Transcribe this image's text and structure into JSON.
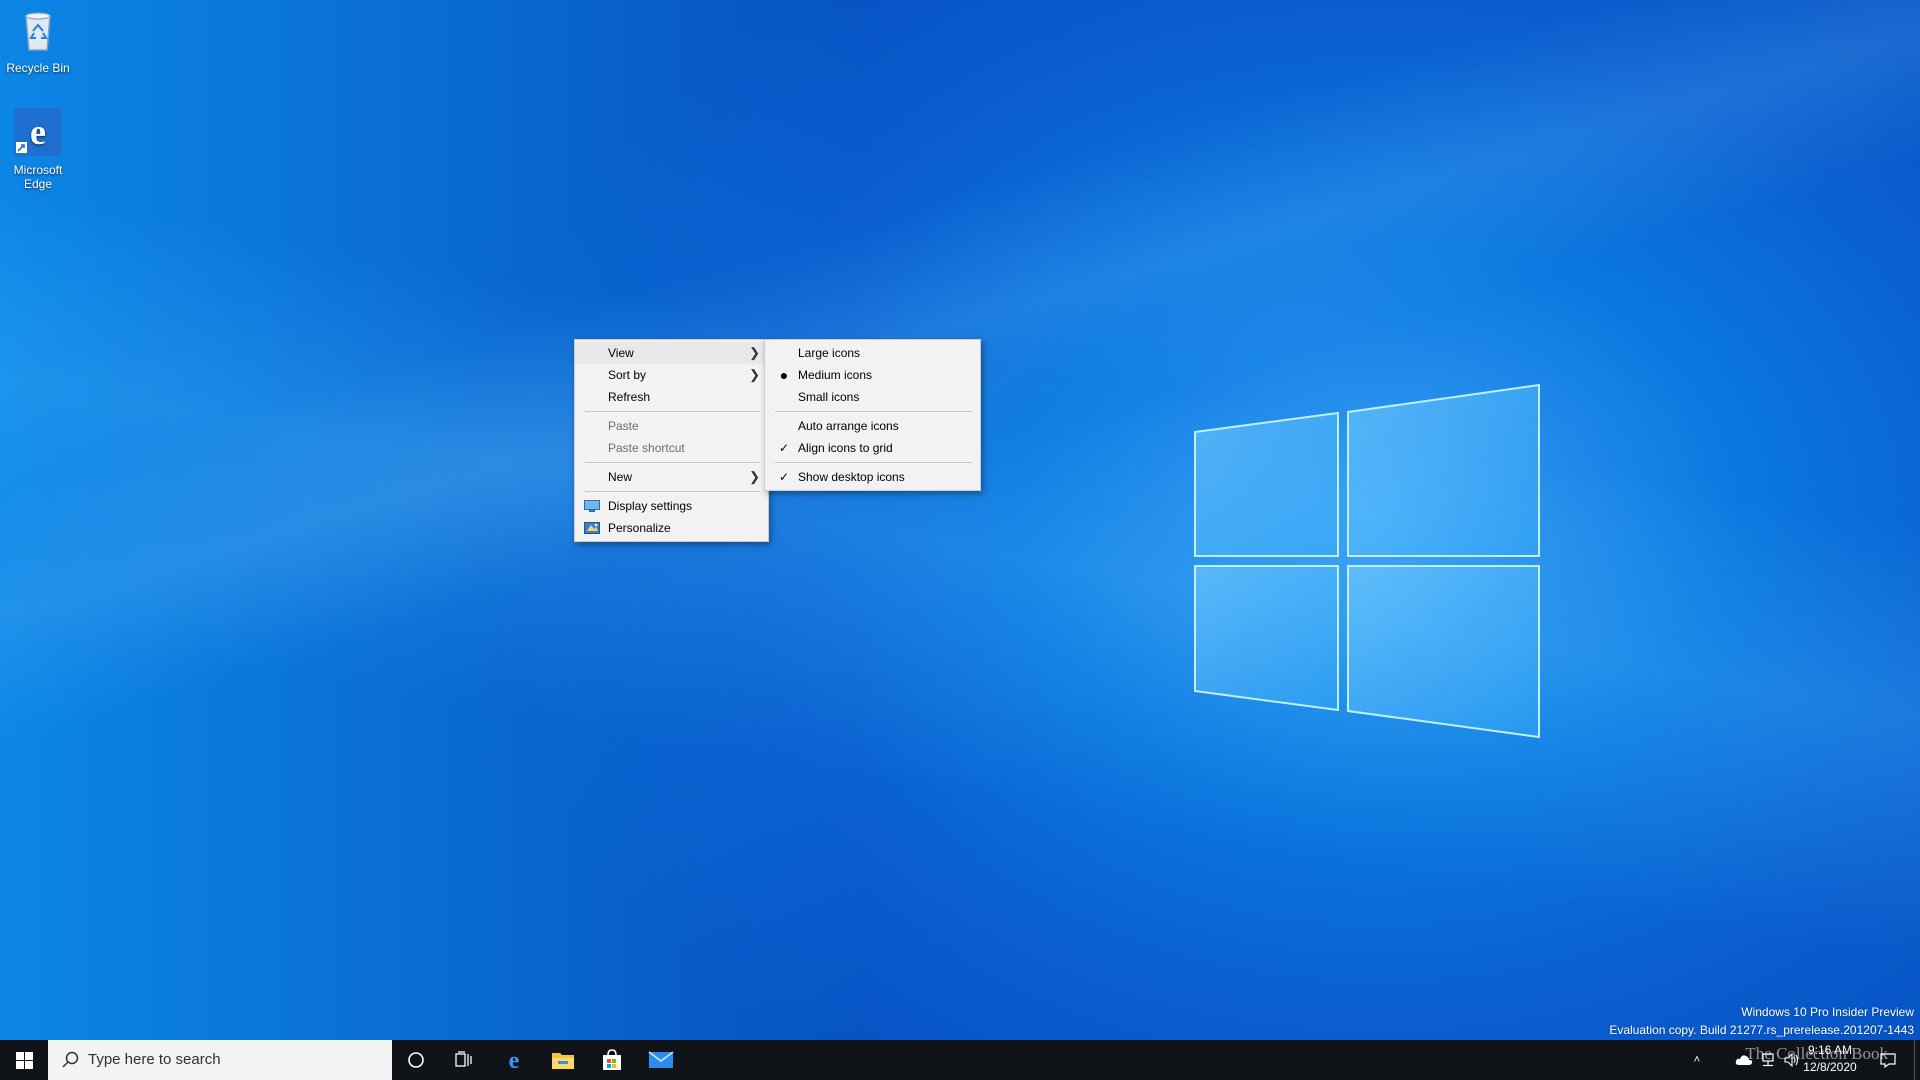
{
  "desktop": {
    "icons": [
      {
        "label": "Recycle Bin"
      },
      {
        "label": "Microsoft Edge"
      }
    ]
  },
  "context_menu": {
    "items": [
      {
        "label": "View",
        "has_submenu": true,
        "highlighted": true
      },
      {
        "label": "Sort by",
        "has_submenu": true
      },
      {
        "label": "Refresh"
      },
      {
        "label": "Paste",
        "disabled": true
      },
      {
        "label": "Paste shortcut",
        "disabled": true
      },
      {
        "label": "New",
        "has_submenu": true
      },
      {
        "label": "Display settings",
        "icon": "display-icon"
      },
      {
        "label": "Personalize",
        "icon": "personalize-icon"
      }
    ]
  },
  "view_submenu": {
    "items": [
      {
        "label": "Large icons"
      },
      {
        "label": "Medium icons",
        "mark": "bullet"
      },
      {
        "label": "Small icons"
      },
      {
        "label": "Auto arrange icons"
      },
      {
        "label": "Align icons to grid",
        "mark": "check"
      },
      {
        "label": "Show desktop icons",
        "mark": "check"
      }
    ]
  },
  "watermark": {
    "line1": "Windows 10 Pro Insider Preview",
    "line2": "Evaluation copy. Build 21277.rs_prerelease.201207-1443"
  },
  "taskbar": {
    "search_placeholder": "Type here to search",
    "pinned": [
      "cortana-icon",
      "task-view-icon",
      "edge-icon",
      "file-explorer-icon",
      "store-icon",
      "mail-icon"
    ],
    "clock": {
      "time": "9:16 AM",
      "date": "12/8/2020"
    },
    "brand_overlay": "The Collection Book"
  },
  "colors": {
    "accent": "#0078d7",
    "menu_bg": "#f2f2f2",
    "taskbar_bg": "#101418"
  }
}
